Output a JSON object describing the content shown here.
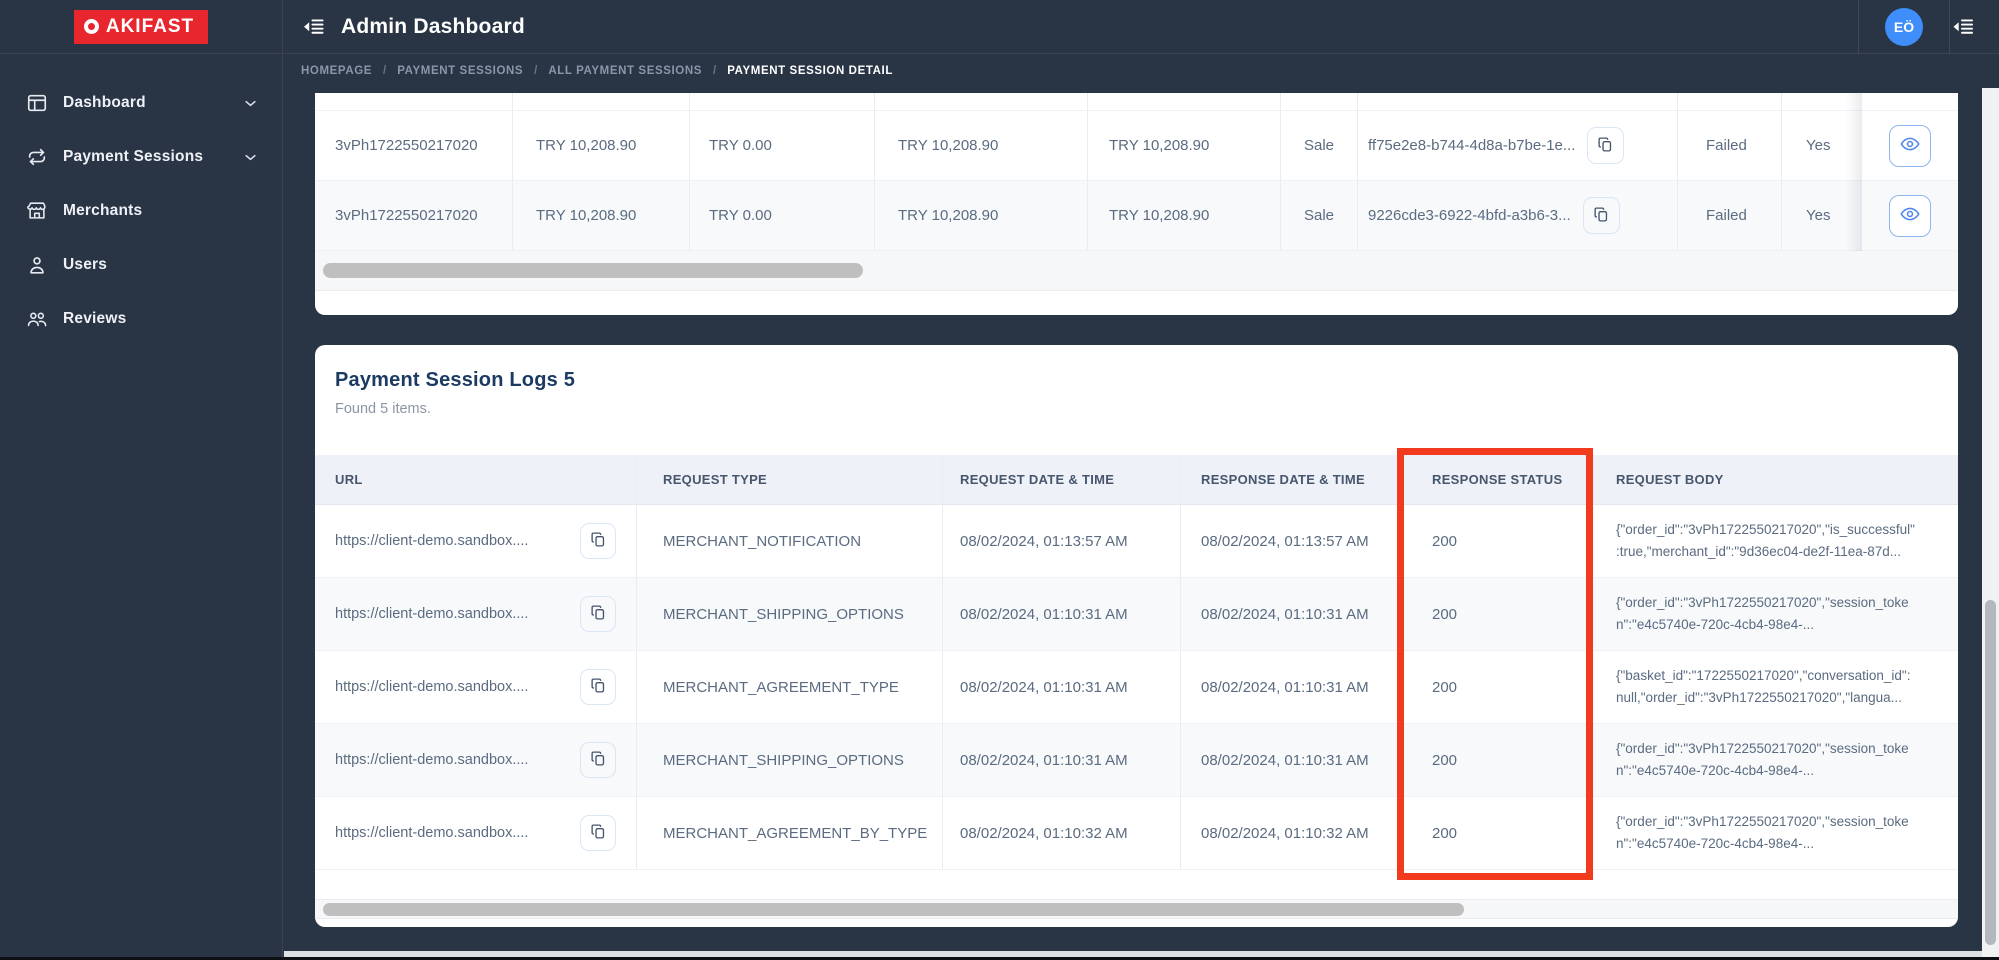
{
  "app": {
    "logo_text": "AKIFAST",
    "title": "Admin Dashboard",
    "avatar_initials": "EÖ"
  },
  "colors": {
    "navy_bg": "#293445",
    "logo_red": "#e8262d",
    "annotation_red": "#f23a1f",
    "avatar_blue": "#3f8efc",
    "eye_button_blue": "#4f86ec",
    "title_navy": "#1c3b63",
    "cell_text": "#5b6b80",
    "table_header_bg": "#eef1f7"
  },
  "sidebar": {
    "items": [
      {
        "label": "Dashboard",
        "icon": "dashboard-icon",
        "expandable": true
      },
      {
        "label": "Payment Sessions",
        "icon": "payment-sessions-icon",
        "expandable": true
      },
      {
        "label": "Merchants",
        "icon": "merchants-icon",
        "expandable": false
      },
      {
        "label": "Users",
        "icon": "users-icon",
        "expandable": false
      },
      {
        "label": "Reviews",
        "icon": "reviews-icon",
        "expandable": false
      }
    ]
  },
  "breadcrumb": {
    "separator": "/",
    "items": [
      "HOMEPAGE",
      "PAYMENT SESSIONS",
      "ALL PAYMENT SESSIONS",
      "PAYMENT SESSION DETAIL"
    ]
  },
  "sessions_table": {
    "rows": [
      {
        "order_no": "3vPh1722550217020",
        "amount": "TRY 10,208.90",
        "refund_amount": "TRY 0.00",
        "net_amount": "TRY 10,208.90",
        "total_amount": "TRY 10,208.90",
        "type": "Sale",
        "transaction_id": "ff75e2e8-b744-4d8a-b7be-1e...",
        "status": "Failed",
        "flag": "Yes"
      },
      {
        "order_no": "3vPh1722550217020",
        "amount": "TRY 10,208.90",
        "refund_amount": "TRY 0.00",
        "net_amount": "TRY 10,208.90",
        "total_amount": "TRY 10,208.90",
        "type": "Sale",
        "transaction_id": "9226cde3-6922-4bfd-a3b6-3...",
        "status": "Failed",
        "flag": "Yes"
      }
    ]
  },
  "logs_table": {
    "title": "Payment Session Logs 5",
    "subtitle": "Found 5 items.",
    "columns": [
      "URL",
      "REQUEST TYPE",
      "REQUEST DATE & TIME",
      "RESPONSE DATE & TIME",
      "RESPONSE STATUS",
      "REQUEST BODY"
    ],
    "rows": [
      {
        "url": "https://client-demo.sandbox....",
        "request_type": "MERCHANT_NOTIFICATION",
        "request_datetime": "08/02/2024, 01:13:57 AM",
        "response_datetime": "08/02/2024, 01:13:57 AM",
        "response_status": "200",
        "request_body_line1": "{\"order_id\":\"3vPh1722550217020\",\"is_successful\"",
        "request_body_line2": ":true,\"merchant_id\":\"9d36ec04-de2f-11ea-87d..."
      },
      {
        "url": "https://client-demo.sandbox....",
        "request_type": "MERCHANT_SHIPPING_OPTIONS",
        "request_datetime": "08/02/2024, 01:10:31 AM",
        "response_datetime": "08/02/2024, 01:10:31 AM",
        "response_status": "200",
        "request_body_line1": "{\"order_id\":\"3vPh1722550217020\",\"session_toke",
        "request_body_line2": "n\":\"e4c5740e-720c-4cb4-98e4-..."
      },
      {
        "url": "https://client-demo.sandbox....",
        "request_type": "MERCHANT_AGREEMENT_TYPE",
        "request_datetime": "08/02/2024, 01:10:31 AM",
        "response_datetime": "08/02/2024, 01:10:31 AM",
        "response_status": "200",
        "request_body_line1": "{\"basket_id\":\"1722550217020\",\"conversation_id\":",
        "request_body_line2": "null,\"order_id\":\"3vPh1722550217020\",\"langua..."
      },
      {
        "url": "https://client-demo.sandbox....",
        "request_type": "MERCHANT_SHIPPING_OPTIONS",
        "request_datetime": "08/02/2024, 01:10:31 AM",
        "response_datetime": "08/02/2024, 01:10:31 AM",
        "response_status": "200",
        "request_body_line1": "{\"order_id\":\"3vPh1722550217020\",\"session_toke",
        "request_body_line2": "n\":\"e4c5740e-720c-4cb4-98e4-..."
      },
      {
        "url": "https://client-demo.sandbox....",
        "request_type": "MERCHANT_AGREEMENT_BY_TYPE",
        "request_datetime": "08/02/2024, 01:10:32 AM",
        "response_datetime": "08/02/2024, 01:10:32 AM",
        "response_status": "200",
        "request_body_line1": "{\"order_id\":\"3vPh1722550217020\",\"session_toke",
        "request_body_line2": "n\":\"e4c5740e-720c-4cb4-98e4-..."
      }
    ]
  }
}
